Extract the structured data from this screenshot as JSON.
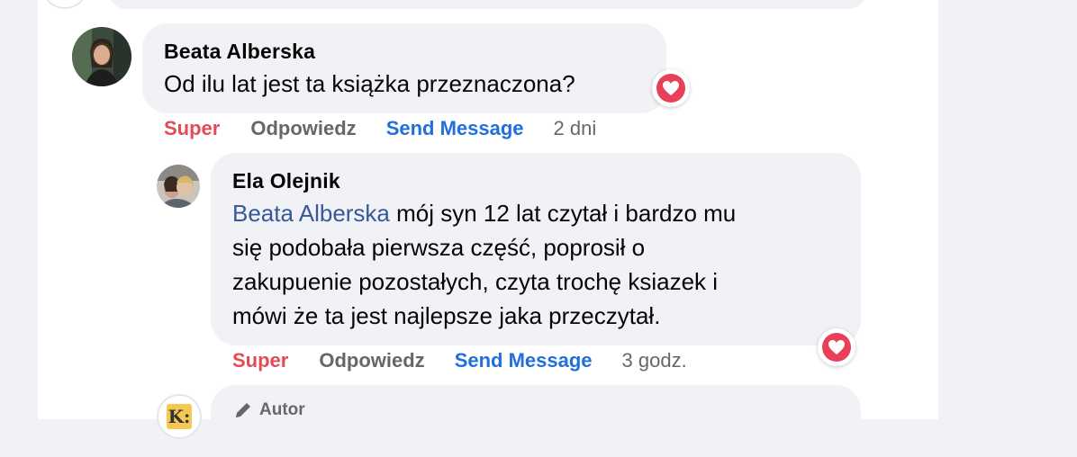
{
  "comments": [
    {
      "author": "Beata Alberska",
      "text": "Od ilu lat jest ta książka przeznaczona?",
      "actions": {
        "react": "Super",
        "reply": "Odpowiedz",
        "send": "Send Message",
        "time": "2 dni"
      }
    },
    {
      "author": "Ela Olejnik",
      "mention": "Beata Alberska",
      "text_lines": [
        " mój syn 12 lat czytał i bardzo mu",
        "się podobała pierwsza część, poprosił o",
        "zakupuenie pozostałych, czyta trochę ksiazek i",
        "mówi że ta jest najlepsze jaka przeczytał."
      ],
      "actions": {
        "react": "Super",
        "reply": "Odpowiedz",
        "send": "Send Message",
        "time": "3 godz."
      }
    }
  ],
  "partial_reply": {
    "badge": "Autor",
    "logo_letter": "K:"
  },
  "colors": {
    "react": "#e34b56",
    "send": "#216fdb",
    "mention": "#385898",
    "heart": "#e8405a"
  }
}
